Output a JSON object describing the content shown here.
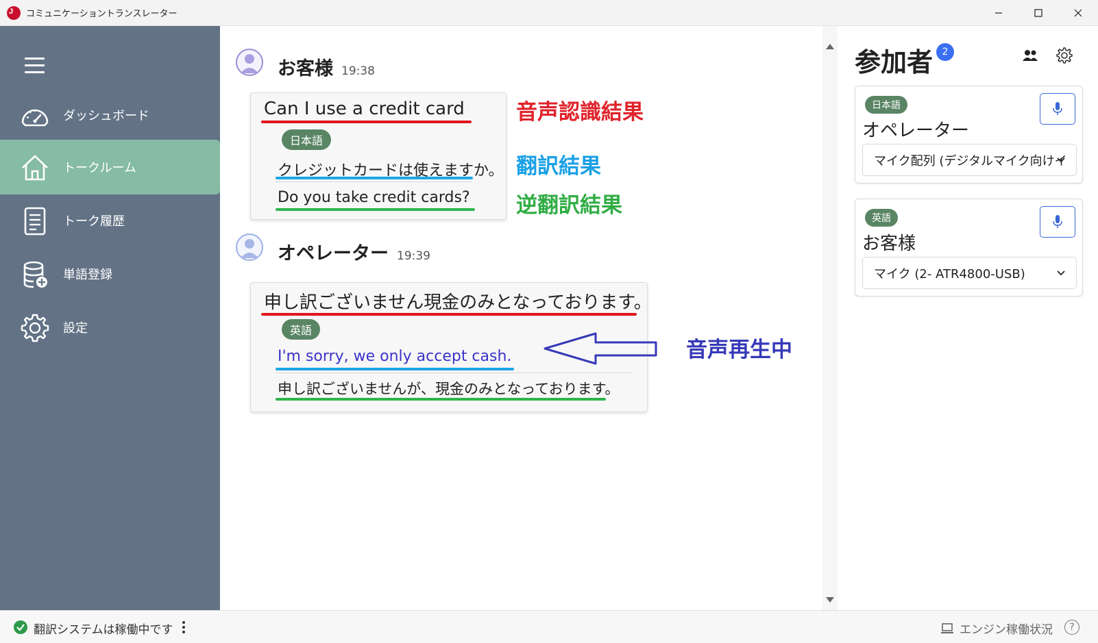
{
  "window": {
    "title": "コミュニケーショントランスレーター",
    "logo_text": "J"
  },
  "sidebar": {
    "items": [
      {
        "label": "ダッシュボード",
        "icon": "dashboard-icon"
      },
      {
        "label": "トークルーム",
        "icon": "home-icon",
        "active": true
      },
      {
        "label": "トーク履歴",
        "icon": "document-icon"
      },
      {
        "label": "単語登録",
        "icon": "database-add-icon"
      },
      {
        "label": "設定",
        "icon": "gear-icon"
      }
    ]
  },
  "chat": {
    "messages": [
      {
        "speaker": "お客様",
        "time": "19:38",
        "recognized": "Can I use a credit card",
        "language": "日本語",
        "translation": "クレジットカードは使えますか。",
        "back_translation": "Do you take credit cards?"
      },
      {
        "speaker": "オペレーター",
        "time": "19:39",
        "recognized": "申し訳ございません現金のみとなっております。",
        "language": "英語",
        "translation": "I'm sorry, we only accept cash.",
        "back_translation": "申し訳ございませんが、現金のみとなっております。"
      }
    ],
    "annotations": {
      "recognition": "音声認識結果",
      "translation": "翻訳結果",
      "back_translation": "逆翻訳結果",
      "playing": "音声再生中"
    }
  },
  "participants": {
    "title": "参加者",
    "count": "2",
    "cards": [
      {
        "language": "日本語",
        "name": "オペレーター",
        "device": "マイク配列 (デジタルマイク向けイ"
      },
      {
        "language": "英語",
        "name": "お客様",
        "device": "マイク (2- ATR4800-USB)"
      }
    ]
  },
  "status": {
    "text": "翻訳システムは稼働中です",
    "engine_label": "エンジン稼働状況",
    "help": "?"
  },
  "colors": {
    "sidebar_bg": "#637285",
    "sidebar_active": "#86bba6",
    "pill_green": "#5a8564",
    "recognition_red": "#e0232b",
    "translation_blue": "#1aa0e6",
    "back_translation_green": "#31ad45",
    "playing_navy": "#3639b8",
    "badge_blue": "#3a6ff2"
  }
}
